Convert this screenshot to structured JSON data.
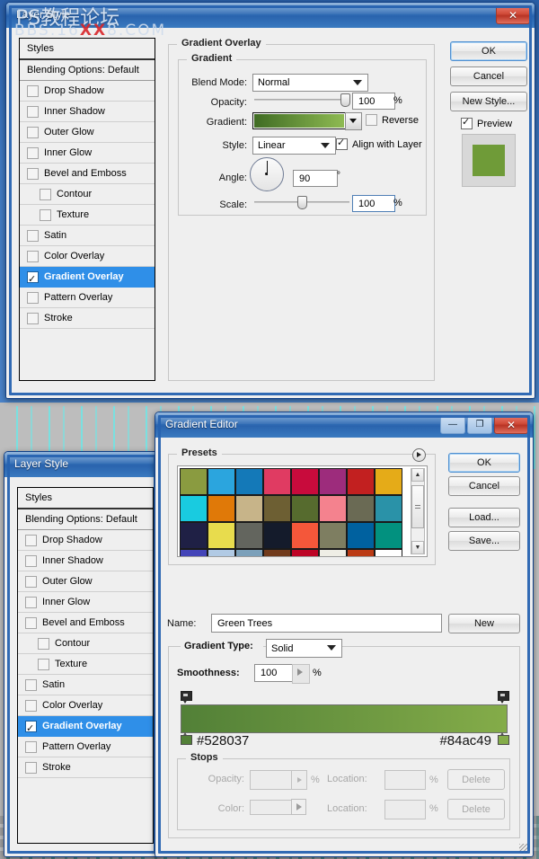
{
  "desktop": {
    "watermark_line1": "PS教程论坛",
    "watermark_line2_a": "BBS.16",
    "watermark_line2_b": "XX",
    "watermark_line2_c": "8.COM"
  },
  "layer_style": {
    "title": "Layer Style",
    "window_buttons": {
      "close": "✕"
    },
    "styles_header": "Styles",
    "blending_options": "Blending Options: Default",
    "items": [
      {
        "label": "Drop Shadow",
        "checked": false,
        "indent": false,
        "selected": false
      },
      {
        "label": "Inner Shadow",
        "checked": false,
        "indent": false,
        "selected": false
      },
      {
        "label": "Outer Glow",
        "checked": false,
        "indent": false,
        "selected": false
      },
      {
        "label": "Inner Glow",
        "checked": false,
        "indent": false,
        "selected": false
      },
      {
        "label": "Bevel and Emboss",
        "checked": false,
        "indent": false,
        "selected": false
      },
      {
        "label": "Contour",
        "checked": false,
        "indent": true,
        "selected": false
      },
      {
        "label": "Texture",
        "checked": false,
        "indent": true,
        "selected": false
      },
      {
        "label": "Satin",
        "checked": false,
        "indent": false,
        "selected": false
      },
      {
        "label": "Color Overlay",
        "checked": false,
        "indent": false,
        "selected": false
      },
      {
        "label": "Gradient Overlay",
        "checked": true,
        "indent": false,
        "selected": true
      },
      {
        "label": "Pattern Overlay",
        "checked": false,
        "indent": false,
        "selected": false
      },
      {
        "label": "Stroke",
        "checked": false,
        "indent": false,
        "selected": false
      }
    ],
    "panel": {
      "section_title": "Gradient Overlay",
      "group_title": "Gradient",
      "blend_mode_label": "Blend Mode:",
      "blend_mode_value": "Normal",
      "opacity_label": "Opacity:",
      "opacity_value": "100",
      "opacity_unit": "%",
      "gradient_label": "Gradient:",
      "reverse_label": "Reverse",
      "reverse_checked": false,
      "style_label": "Style:",
      "style_value": "Linear",
      "align_label": "Align with Layer",
      "align_checked": true,
      "angle_label": "Angle:",
      "angle_value": "90",
      "angle_unit": "°",
      "scale_label": "Scale:",
      "scale_value": "100",
      "scale_unit": "%",
      "gradient_from": "#3f6b23",
      "gradient_to": "#8fbb53"
    },
    "buttons": {
      "ok": "OK",
      "cancel": "Cancel",
      "new_style": "New Style..."
    },
    "preview_label": "Preview",
    "preview_checked": true,
    "preview_color": "#6f9b38"
  },
  "gradient_editor": {
    "title": "Gradient Editor",
    "window_buttons": {
      "minimize": "—",
      "maximize": "❐",
      "close": "✕"
    },
    "presets_label": "Presets",
    "presets_swatches": [
      "#8a9b40",
      "#2ba5de",
      "#1479b8",
      "#e03b62",
      "#c80b3c",
      "#9d2c7c",
      "#c22020",
      "#e5ab18",
      "#19cbe0",
      "#e07908",
      "#c7b489",
      "#6d5f33",
      "#566b2e",
      "#f4828e",
      "#6a6a54",
      "#2a92a8",
      "#1f2045",
      "#e8dc4d",
      "#63655e",
      "#141b2b",
      "#f4573a",
      "#7e7e61",
      "#00619f",
      "#02917f",
      "#4344b8",
      "#b1cae4",
      "#7ba0ba",
      "#713b1c",
      "#bd0426",
      "#efeee6",
      "#bb3b15",
      "#ffffff"
    ],
    "buttons": {
      "ok": "OK",
      "cancel": "Cancel",
      "load": "Load...",
      "save": "Save...",
      "new": "New"
    },
    "name_label": "Name:",
    "name_value": "Green Trees",
    "gradient_type_label": "Gradient Type:",
    "gradient_type_value": "Solid",
    "smoothness_label": "Smoothness:",
    "smoothness_value": "100",
    "smoothness_unit": "%",
    "gradient_from": "#528037",
    "gradient_to": "#84ac49",
    "stop_left_hex": "#528037",
    "stop_right_hex": "#84ac49",
    "stops_group_label": "Stops",
    "opacity_label": "Opacity:",
    "opacity_unit": "%",
    "color_label": "Color:",
    "location_label_1": "Location:",
    "location_label_2": "Location:",
    "location_unit_1": "%",
    "location_unit_2": "%",
    "delete_label_1": "Delete",
    "delete_label_2": "Delete"
  },
  "layer_style_2": {
    "title": "Layer Style",
    "styles_header": "Styles",
    "blending_options": "Blending Options: Default",
    "items": [
      {
        "label": "Drop Shadow",
        "checked": false,
        "indent": false,
        "selected": false
      },
      {
        "label": "Inner Shadow",
        "checked": false,
        "indent": false,
        "selected": false
      },
      {
        "label": "Outer Glow",
        "checked": false,
        "indent": false,
        "selected": false
      },
      {
        "label": "Inner Glow",
        "checked": false,
        "indent": false,
        "selected": false
      },
      {
        "label": "Bevel and Emboss",
        "checked": false,
        "indent": false,
        "selected": false
      },
      {
        "label": "Contour",
        "checked": false,
        "indent": true,
        "selected": false
      },
      {
        "label": "Texture",
        "checked": false,
        "indent": true,
        "selected": false
      },
      {
        "label": "Satin",
        "checked": false,
        "indent": false,
        "selected": false
      },
      {
        "label": "Color Overlay",
        "checked": false,
        "indent": false,
        "selected": false
      },
      {
        "label": "Gradient Overlay",
        "checked": true,
        "indent": false,
        "selected": true
      },
      {
        "label": "Pattern Overlay",
        "checked": false,
        "indent": false,
        "selected": false
      },
      {
        "label": "Stroke",
        "checked": false,
        "indent": false,
        "selected": false
      }
    ]
  }
}
